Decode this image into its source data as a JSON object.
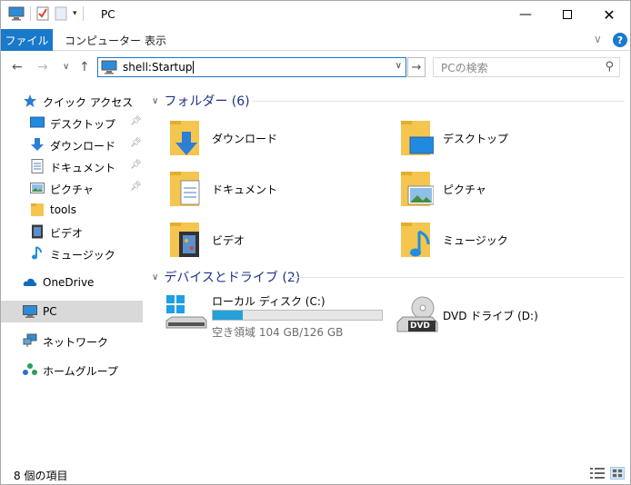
{
  "window": {
    "title": "PC"
  },
  "ribbon": {
    "tabs": [
      "ファイル",
      "コンピューター",
      "表示"
    ],
    "help": "?"
  },
  "nav": {
    "address_value": "shell:Startup",
    "search_placeholder": "PCの検索"
  },
  "sidebar": {
    "quick_access": "クイック アクセス",
    "pinned": [
      "デスクトップ",
      "ダウンロード",
      "ドキュメント",
      "ピクチャ"
    ],
    "recent": [
      "tools",
      "ビデオ",
      "ミュージック"
    ],
    "onedrive": "OneDrive",
    "pc": "PC",
    "network": "ネットワーク",
    "homegroup": "ホームグループ"
  },
  "main": {
    "folders_header": "フォルダー (6)",
    "folders": [
      "ダウンロード",
      "デスクトップ",
      "ドキュメント",
      "ピクチャ",
      "ビデオ",
      "ミュージック"
    ],
    "drives_header": "デバイスとドライブ (2)",
    "drive_c": {
      "name": "ローカル ディスク (C:)",
      "free": "空き領域 104 GB/126 GB",
      "used_fraction": 0.175
    },
    "drive_d": {
      "name": "DVD ドライブ (D:)",
      "badge": "DVD"
    }
  },
  "status": {
    "items": "8 個の項目"
  },
  "colors": {
    "accent": "#1979ca",
    "folder": "#f4c54f",
    "header": "#1e3287",
    "drive_bar": "#26a0da"
  }
}
